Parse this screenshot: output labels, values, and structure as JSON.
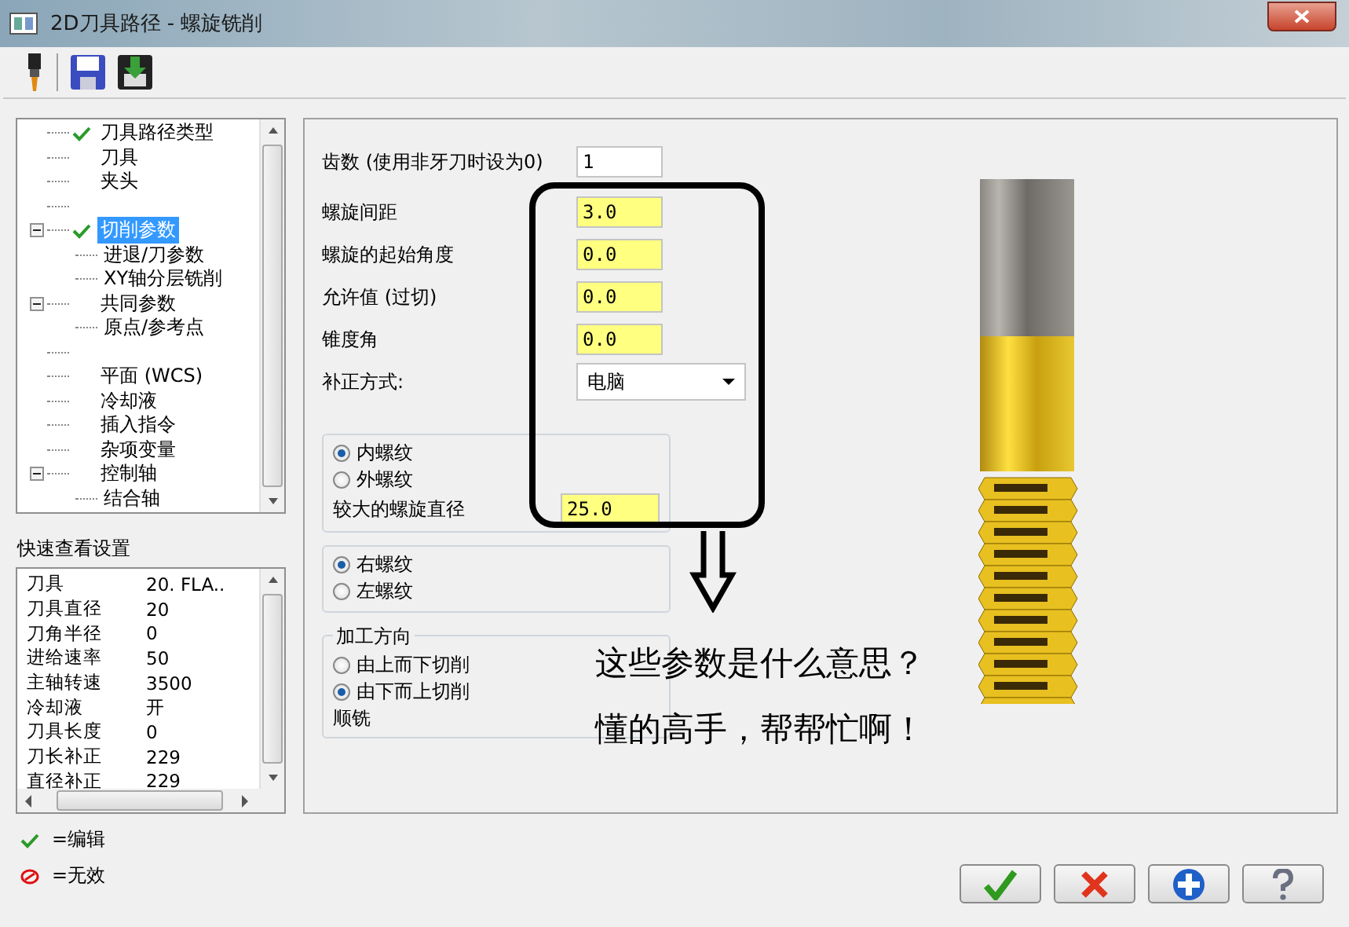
{
  "window": {
    "title": "2D刀具路径 - 螺旋铣削"
  },
  "tree": [
    {
      "kind": "item",
      "label": "刀具路径类型",
      "checked": true,
      "selected": false
    },
    {
      "kind": "item",
      "label": "刀具",
      "checked": false,
      "selected": false
    },
    {
      "kind": "item",
      "label": "夹头",
      "checked": false,
      "selected": false
    },
    {
      "kind": "blank"
    },
    {
      "kind": "item",
      "label": "切削参数",
      "checked": true,
      "selected": true,
      "expanded": true,
      "children": [
        {
          "kind": "item",
          "label": "进退/刀参数",
          "selected": false
        },
        {
          "kind": "item",
          "label": "XY轴分层铣削",
          "selected": false
        }
      ]
    },
    {
      "kind": "item",
      "label": "共同参数",
      "checked": false,
      "selected": false,
      "expanded": true,
      "children": [
        {
          "kind": "item",
          "label": "原点/参考点",
          "selected": false
        }
      ]
    },
    {
      "kind": "blank"
    },
    {
      "kind": "item",
      "label": "平面 (WCS)",
      "checked": false,
      "selected": false
    },
    {
      "kind": "item",
      "label": "冷却液",
      "checked": false,
      "selected": false
    },
    {
      "kind": "item",
      "label": "插入指令",
      "checked": false,
      "selected": false
    },
    {
      "kind": "item",
      "label": "杂项变量",
      "checked": false,
      "selected": false
    },
    {
      "kind": "item",
      "label": "控制轴",
      "checked": false,
      "selected": false,
      "expanded": true,
      "children": [
        {
          "kind": "item",
          "label": "结合轴",
          "selected": false
        }
      ]
    }
  ],
  "quick_view": {
    "title": "快速查看设置",
    "rows": [
      {
        "name": "刀具",
        "value": "20. FLA.."
      },
      {
        "name": "刀具直径",
        "value": "20"
      },
      {
        "name": "刀角半径",
        "value": "0"
      },
      {
        "name": "进给速率",
        "value": "50"
      },
      {
        "name": "主轴转速",
        "value": "3500"
      },
      {
        "name": "冷却液",
        "value": "开"
      },
      {
        "name": "刀具长度",
        "value": "0"
      },
      {
        "name": "刀长补正",
        "value": "229"
      },
      {
        "name": "直径补正",
        "value": "229"
      }
    ]
  },
  "legend": [
    {
      "kind": "check",
      "label": "=编辑"
    },
    {
      "kind": "invalid",
      "label": "=无效"
    }
  ],
  "form": {
    "fields": [
      {
        "label": "齿数 (使用非牙刀时设为0)",
        "value": "1",
        "highlighted": false
      },
      {
        "label": "螺旋间距",
        "value": "3.0",
        "highlighted": true
      },
      {
        "label": "螺旋的起始角度",
        "value": "0.0",
        "highlighted": true
      },
      {
        "label": "允许值 (过切)",
        "value": "0.0",
        "highlighted": true
      },
      {
        "label": "锥度角",
        "value": "0.0",
        "highlighted": true
      }
    ],
    "compensation": {
      "label": "补正方式:",
      "value": "电脑"
    },
    "thread_type": {
      "options": [
        {
          "label": "内螺纹",
          "selected": true
        },
        {
          "label": "外螺纹",
          "selected": false
        }
      ],
      "diameter": {
        "label": "较大的螺旋直径",
        "value": "25.0",
        "highlighted": true
      }
    },
    "hand": {
      "options": [
        {
          "label": "右螺纹",
          "selected": true
        },
        {
          "label": "左螺纹",
          "selected": false
        }
      ]
    },
    "direction": {
      "title": "加工方向",
      "options": [
        {
          "label": "由上而下切削",
          "selected": false
        },
        {
          "label": "由下而上切削",
          "selected": true
        }
      ],
      "note": "顺铣"
    }
  },
  "annotation": {
    "lines": [
      "这些参数是什么意思？",
      "懂的高手，帮帮忙啊！"
    ]
  },
  "buttons": [
    {
      "kind": "ok"
    },
    {
      "kind": "cancel"
    },
    {
      "kind": "add"
    },
    {
      "kind": "help"
    }
  ]
}
